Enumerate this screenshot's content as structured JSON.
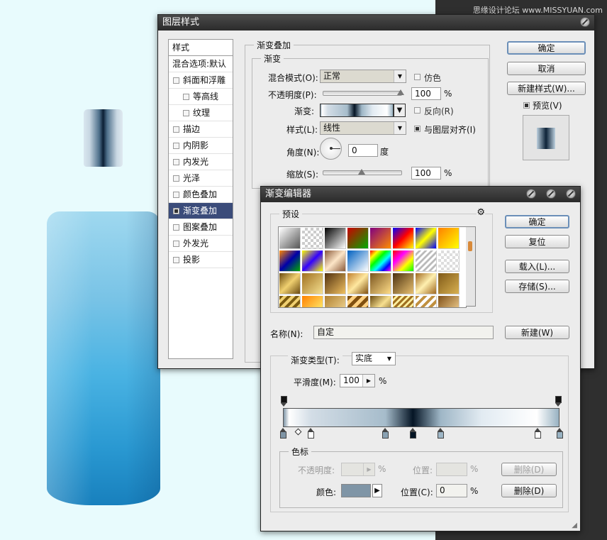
{
  "watermark": "思缘设计论坛 www.MISSYUAN.com",
  "layer_style": {
    "title": "图层样式",
    "styles_header": "样式",
    "styles": [
      {
        "label": "混合选项:默认",
        "type": "head"
      },
      {
        "label": "斜面和浮雕",
        "checked": false
      },
      {
        "label": "等高线",
        "checked": false,
        "indent": true
      },
      {
        "label": "纹理",
        "checked": false,
        "indent": true
      },
      {
        "label": "描边",
        "checked": false
      },
      {
        "label": "内阴影",
        "checked": false
      },
      {
        "label": "内发光",
        "checked": false
      },
      {
        "label": "光泽",
        "checked": false
      },
      {
        "label": "颜色叠加",
        "checked": false
      },
      {
        "label": "渐变叠加",
        "checked": true,
        "selected": true
      },
      {
        "label": "图案叠加",
        "checked": false
      },
      {
        "label": "外发光",
        "checked": false
      },
      {
        "label": "投影",
        "checked": false
      }
    ],
    "section_title": "渐变叠加",
    "group_title": "渐变",
    "blend_mode_label": "混合模式(O):",
    "blend_mode_value": "正常",
    "dither_label": "仿色",
    "opacity_label": "不透明度(P):",
    "opacity_value": "100",
    "percent": "%",
    "gradient_label": "渐变:",
    "reverse_label": "反向(R)",
    "style_label": "样式(L):",
    "style_value": "线性",
    "align_label": "与图层对齐(I)",
    "angle_label": "角度(N):",
    "angle_value": "0",
    "degree_unit": "度",
    "scale_label": "缩放(S):",
    "scale_value": "100",
    "ok": "确定",
    "cancel": "取消",
    "new_style": "新建样式(W)...",
    "preview_label": "预览(V)",
    "opacity_pct": 100,
    "scale_pct": 100
  },
  "gradient_editor": {
    "title": "渐变编辑器",
    "presets_label": "预设",
    "ok": "确定",
    "reset": "复位",
    "load": "载入(L)...",
    "save": "存储(S)...",
    "name_label": "名称(N):",
    "name_value": "自定",
    "new": "新建(W)",
    "type_label": "渐变类型(T):",
    "type_value": "实底",
    "smooth_label": "平滑度(M):",
    "smooth_value": "100",
    "percent": "%",
    "stops_group": "色标",
    "opacity_label": "不透明度:",
    "location_label_1": "位置:",
    "delete_1": "删除(D)",
    "color_label": "颜色:",
    "location_label_2": "位置(C):",
    "location_value": "0",
    "delete_2": "删除(D)",
    "stop_color": "#7f95a6",
    "gradient_colors": [
      "#7f95a6",
      "#ffffff",
      "#d3dde6",
      "#a6bccb",
      "#051525",
      "#9eb6c6",
      "#e2ebf2",
      "#ffffff",
      "#98b2c2"
    ]
  }
}
